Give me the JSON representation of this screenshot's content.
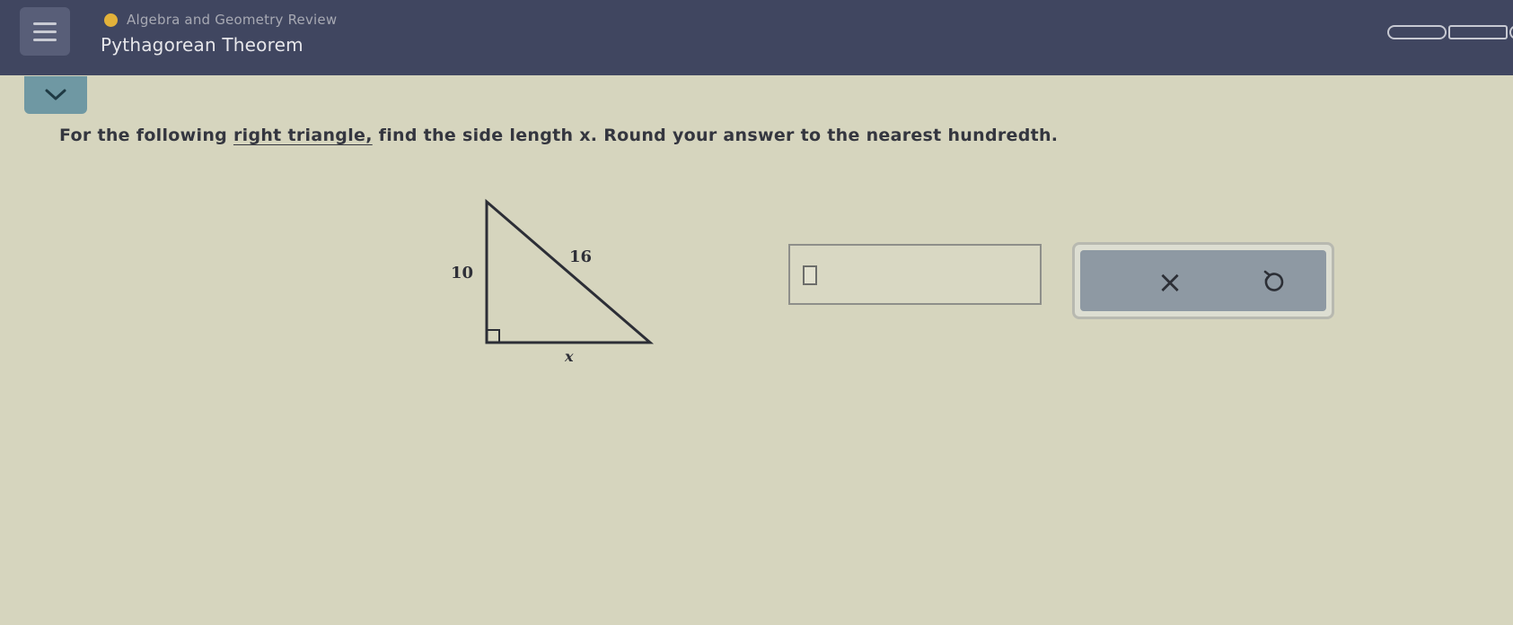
{
  "header": {
    "course_title": "Algebra and Geometry Review",
    "topic_title": "Pythagorean Theorem",
    "menu_icon": "hamburger-icon",
    "status_dot_color": "#e3b23a",
    "progress_segments": 3
  },
  "collapse_icon": "chevron-down-icon",
  "question": {
    "before": "For the following ",
    "term": "right triangle,",
    "after": " find the side length x. Round your answer to the nearest hundredth."
  },
  "diagram": {
    "vertical_leg_label": "10",
    "hypotenuse_label": "16",
    "base_label": "x",
    "right_angle_marker": "right-angle-icon"
  },
  "answer": {
    "value": ""
  },
  "actions": {
    "clear_label": "×",
    "clear_icon": "close-icon",
    "undo_icon": "undo-icon"
  }
}
